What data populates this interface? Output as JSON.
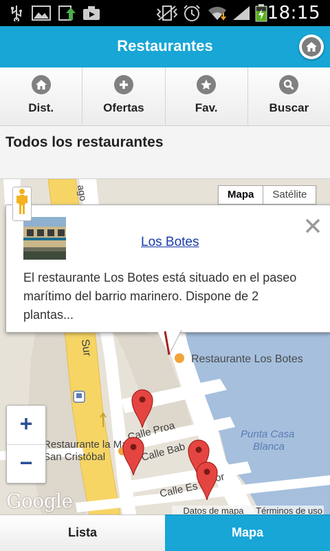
{
  "status_bar": {
    "time": "18:15",
    "icons": [
      "usb-icon",
      "image-icon",
      "upload-icon",
      "camera-icon",
      "vibrate-icon",
      "alarm-icon",
      "wifi-icon",
      "signal-icon",
      "battery-charging-icon"
    ]
  },
  "header": {
    "title": "Restaurantes",
    "home_icon": "home-icon"
  },
  "nav": {
    "items": [
      {
        "label": "Dist.",
        "icon": "home-icon"
      },
      {
        "label": "Ofertas",
        "icon": "plus-icon"
      },
      {
        "label": "Fav.",
        "icon": "star-icon"
      },
      {
        "label": "Buscar",
        "icon": "search-icon"
      }
    ]
  },
  "section": {
    "title": "Todos los restaurantes"
  },
  "map": {
    "map_type": {
      "map": "Mapa",
      "satellite": "Satélite"
    },
    "info_window": {
      "title": "Los Botes",
      "description": "El restaurante Los Botes está situado en el paseo marítimo del barrio marinero. Dispone de 2 plantas..."
    },
    "labels": {
      "poi_1": "Restaurante Los Botes",
      "poi_2a": "Restaurante la Marea",
      "poi_2b": "San Cristóbal",
      "area_1": "Punta Casa",
      "area_2": "Blanca",
      "street_1": "Calle Proa",
      "street_2": "Calle Bab",
      "street_3": "Calle Es",
      "street_3b": "or",
      "road_1": "Sur",
      "road_2": "ago"
    },
    "zoom_in": "+",
    "zoom_out": "−",
    "logo": "Google",
    "attribution": {
      "data": "Datos de mapa",
      "terms": "Términos de uso"
    },
    "colors": {
      "water": "#a5bfdd",
      "road_major": "#f6d565",
      "land": "#e7e2d8",
      "pin": "#e54541"
    }
  },
  "tabs": {
    "list": "Lista",
    "map": "Mapa"
  },
  "colors": {
    "accent": "#17a6d6"
  }
}
